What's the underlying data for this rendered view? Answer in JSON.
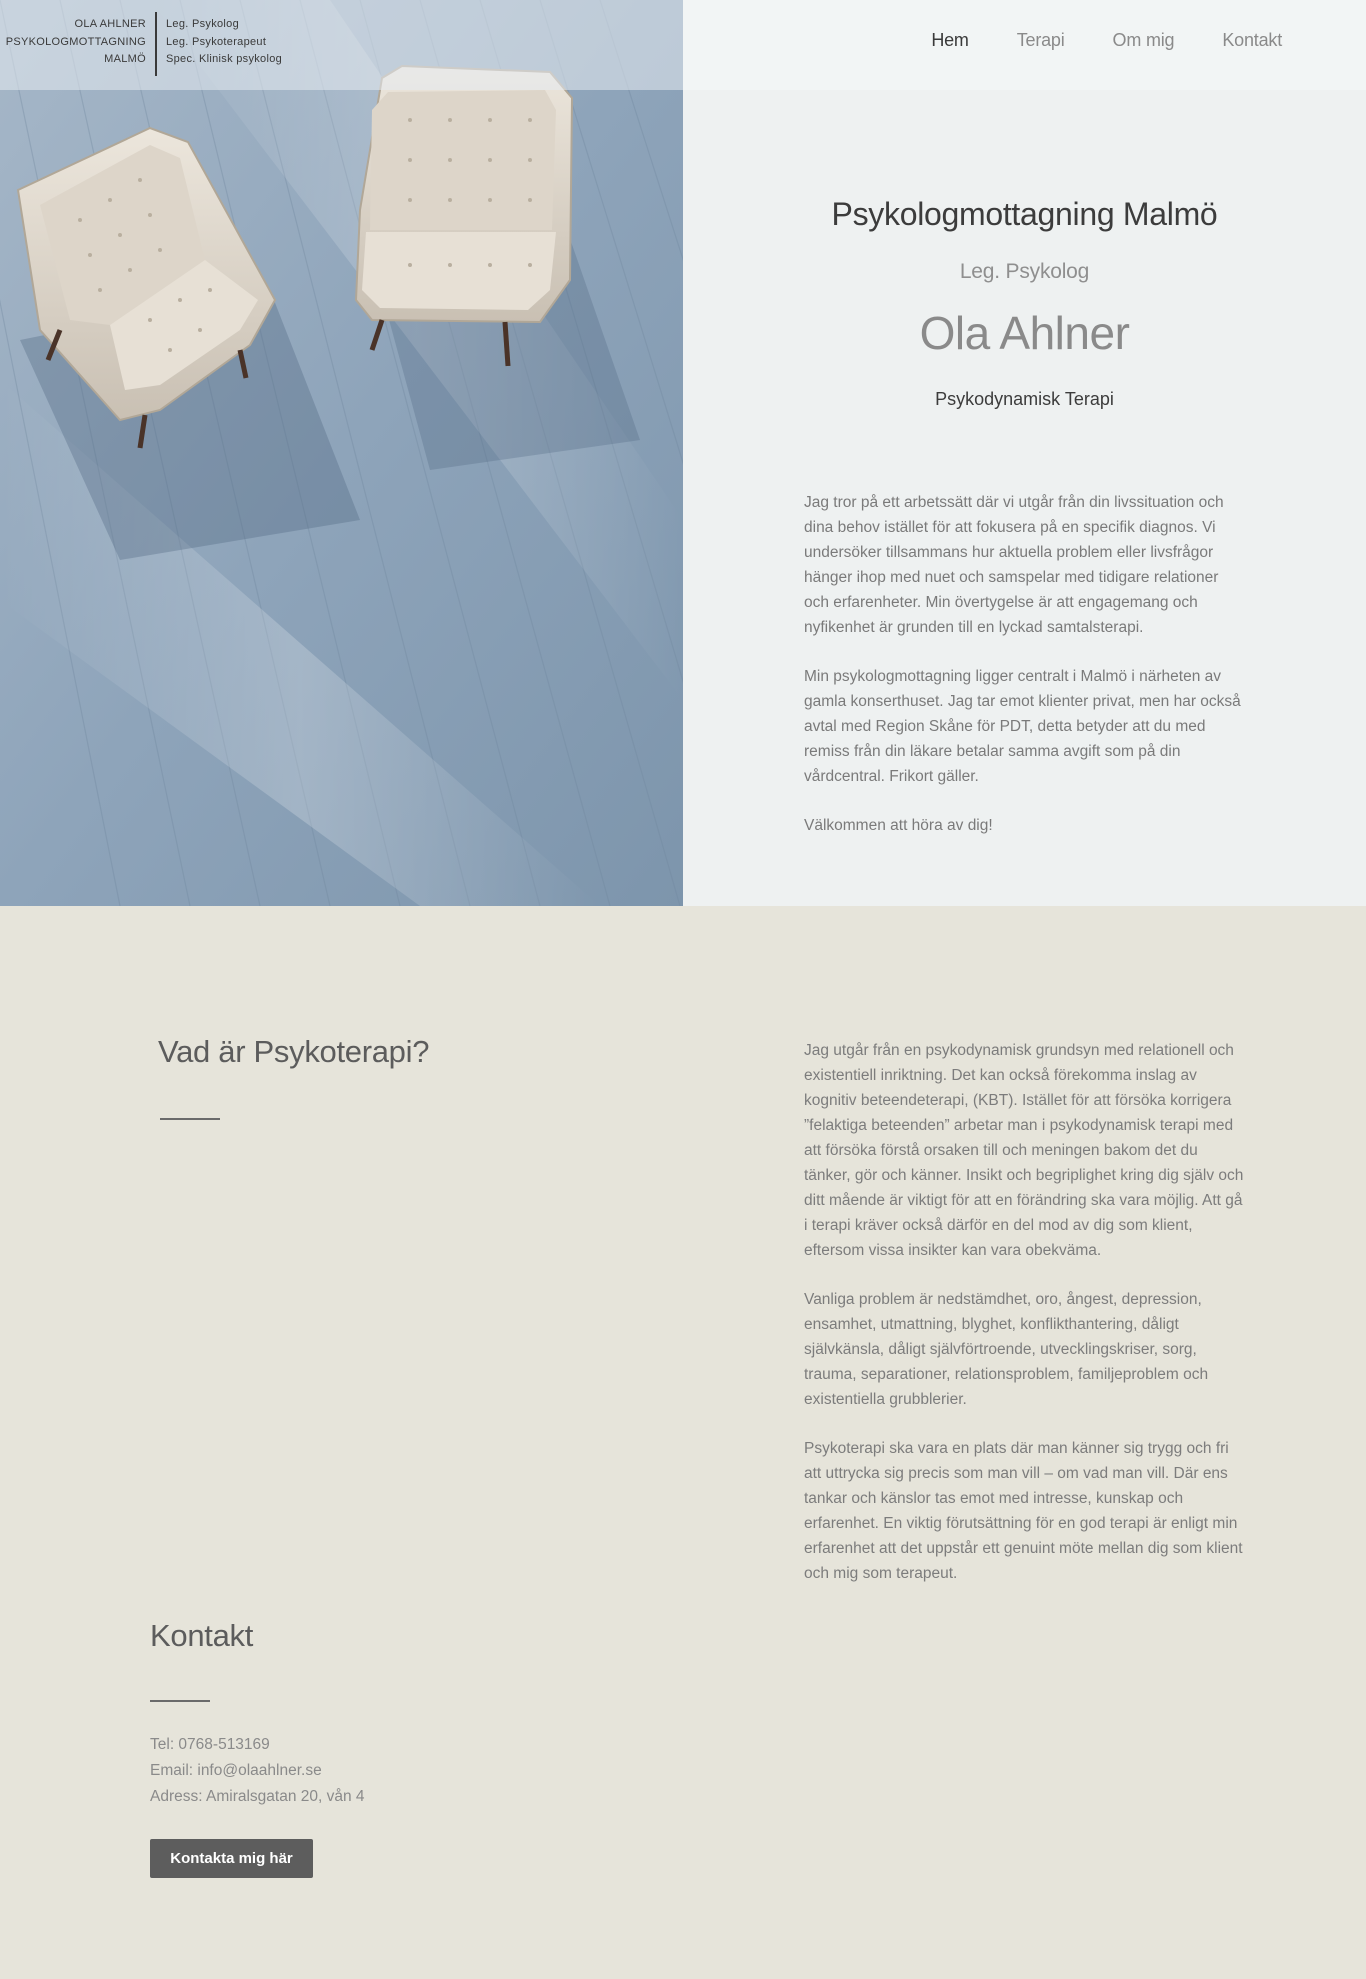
{
  "header": {
    "logo": {
      "left_lines": [
        "OLA AHLNER",
        "PSYKOLOGMOTTAGNING",
        "MALMÖ"
      ],
      "right_lines": [
        "Leg. Psykolog",
        "Leg. Psykoterapeut",
        "Spec. Klinisk psykolog"
      ]
    },
    "nav": [
      {
        "label": "Hem",
        "active": true
      },
      {
        "label": "Terapi",
        "active": false
      },
      {
        "label": "Om mig",
        "active": false
      },
      {
        "label": "Kontakt",
        "active": false
      }
    ]
  },
  "hero": {
    "image_subject": "two-armchairs-photo",
    "title": "Psykologmottagning Malmö",
    "subtitle": "Leg. Psykolog",
    "name": "Ola Ahlner",
    "tagline": "Psykodynamisk Terapi",
    "paragraphs": [
      "Jag tror på ett arbetssätt där vi utgår från din livssituation och dina behov istället för att fokusera på en specifik diagnos. Vi undersöker tillsammans hur aktuella problem eller livsfrågor hänger ihop med nuet och samspelar med tidigare relationer och erfarenheter. Min övertygelse är att engagemang och nyfikenhet är grunden till en lyckad samtalsterapi.",
      "Min psykologmottagning ligger centralt i Malmö i närheten av gamla konserthuset. Jag tar emot klienter privat, men har också avtal med Region Skåne för PDT, detta betyder att du med remiss från din läkare betalar samma avgift som på din vårdcentral. Frikort gäller.",
      "Välkommen att höra av dig!"
    ]
  },
  "psykoterapi": {
    "title": "Vad är Psykoterapi?",
    "paragraphs": [
      "Jag utgår från en psykodynamisk grundsyn med relationell och existentiell inriktning. Det kan också förekomma   inslag av kognitiv beteendeterapi, (KBT). Istället för att försöka korrigera ”felaktiga beteenden” arbetar man i psykodynamisk terapi med att försöka förstå orsaken till och meningen bakom det du tänker, gör och känner. Insikt och begriplighet kring dig själv och ditt mående är viktigt för att en förändring ska vara möjlig. Att gå i terapi kräver också därför en del mod av dig som klient, eftersom vissa insikter kan vara obekväma.",
      "Vanliga problem är nedstämdhet, oro, ångest, depression, ensamhet, utmattning, blyghet, konflikthantering, dåligt självkänsla, dåligt självförtroende, utvecklingskriser, sorg, trauma, separationer, relationsproblem, familjeproblem och existentiella grubblerier.",
      "Psykoterapi ska vara en plats där man känner sig trygg och fri att uttrycka sig precis som man vill – om vad man vill. Där ens tankar och känslor tas emot med intresse, kunskap och erfarenhet. En viktig förutsättning för en god terapi är enligt min erfarenhet att det uppstår ett genuint möte mellan dig som klient och mig som terapeut."
    ]
  },
  "kontakt": {
    "title": "Kontakt",
    "phone": "Tel: 0768-513169",
    "email": "Email: info@olaahlner.se",
    "address": "Adress: Amiralsgatan 20, vån 4",
    "button_label": "Kontakta mig här"
  },
  "colors": {
    "hero_panel_bg": "#eef1f1",
    "page_bg": "#e6e4da",
    "button_bg": "#5d5d5d",
    "heading_text": "#3c3c3c"
  }
}
